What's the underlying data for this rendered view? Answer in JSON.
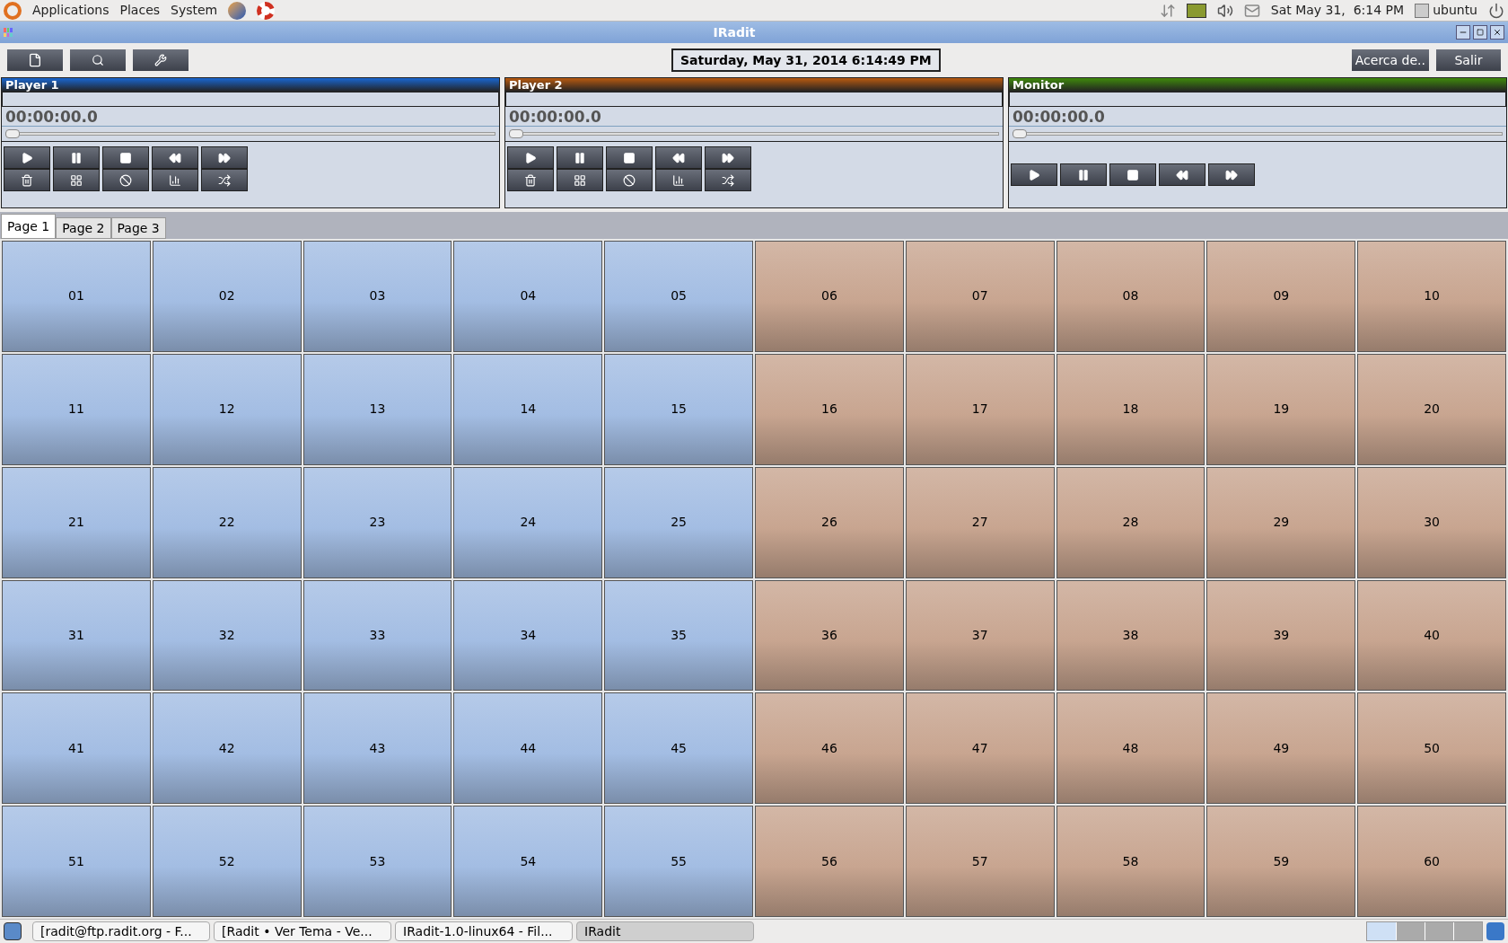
{
  "top_panel": {
    "menus": [
      "Applications",
      "Places",
      "System"
    ],
    "clock": "Sat May 31,  6:14 PM",
    "user": "ubuntu"
  },
  "window": {
    "title": "IRadit"
  },
  "toolbar": {
    "date": "Saturday, May 31, 2014 6:14:49 PM",
    "about": "Acerca de..",
    "exit": "Salir"
  },
  "players": [
    {
      "title": "Player 1",
      "color": "#1a66d0",
      "time": "00:00:00.0",
      "level": 0,
      "kind": "player"
    },
    {
      "title": "Player 2",
      "color": "#b85a10",
      "time": "00:00:00.0",
      "level": 0,
      "kind": "player"
    },
    {
      "title": "Monitor",
      "color": "#3f8a0c",
      "time": "00:00:00.0",
      "level": 0,
      "kind": "monitor"
    }
  ],
  "tabs": [
    {
      "label": "Page 1",
      "selected": true
    },
    {
      "label": "Page 2",
      "selected": false
    },
    {
      "label": "Page 3",
      "selected": false
    }
  ],
  "pads": [
    {
      "label": "01",
      "color": "#a3bde3"
    },
    {
      "label": "02",
      "color": "#a3bde3"
    },
    {
      "label": "03",
      "color": "#a3bde3"
    },
    {
      "label": "04",
      "color": "#a3bde3"
    },
    {
      "label": "05",
      "color": "#a3bde3"
    },
    {
      "label": "06",
      "color": "#c8a590"
    },
    {
      "label": "07",
      "color": "#c8a590"
    },
    {
      "label": "08",
      "color": "#c8a590"
    },
    {
      "label": "09",
      "color": "#c8a590"
    },
    {
      "label": "10",
      "color": "#c8a590"
    },
    {
      "label": "11",
      "color": "#a3bde3"
    },
    {
      "label": "12",
      "color": "#a3bde3"
    },
    {
      "label": "13",
      "color": "#a3bde3"
    },
    {
      "label": "14",
      "color": "#a3bde3"
    },
    {
      "label": "15",
      "color": "#a3bde3"
    },
    {
      "label": "16",
      "color": "#c8a590"
    },
    {
      "label": "17",
      "color": "#c8a590"
    },
    {
      "label": "18",
      "color": "#c8a590"
    },
    {
      "label": "19",
      "color": "#c8a590"
    },
    {
      "label": "20",
      "color": "#c8a590"
    },
    {
      "label": "21",
      "color": "#a3bde3"
    },
    {
      "label": "22",
      "color": "#a3bde3"
    },
    {
      "label": "23",
      "color": "#a3bde3"
    },
    {
      "label": "24",
      "color": "#a3bde3"
    },
    {
      "label": "25",
      "color": "#a3bde3"
    },
    {
      "label": "26",
      "color": "#c8a590"
    },
    {
      "label": "27",
      "color": "#c8a590"
    },
    {
      "label": "28",
      "color": "#c8a590"
    },
    {
      "label": "29",
      "color": "#c8a590"
    },
    {
      "label": "30",
      "color": "#c8a590"
    },
    {
      "label": "31",
      "color": "#a3bde3"
    },
    {
      "label": "32",
      "color": "#a3bde3"
    },
    {
      "label": "33",
      "color": "#a3bde3"
    },
    {
      "label": "34",
      "color": "#a3bde3"
    },
    {
      "label": "35",
      "color": "#a3bde3"
    },
    {
      "label": "36",
      "color": "#c8a590"
    },
    {
      "label": "37",
      "color": "#c8a590"
    },
    {
      "label": "38",
      "color": "#c8a590"
    },
    {
      "label": "39",
      "color": "#c8a590"
    },
    {
      "label": "40",
      "color": "#c8a590"
    },
    {
      "label": "41",
      "color": "#a3bde3"
    },
    {
      "label": "42",
      "color": "#a3bde3"
    },
    {
      "label": "43",
      "color": "#a3bde3"
    },
    {
      "label": "44",
      "color": "#a3bde3"
    },
    {
      "label": "45",
      "color": "#a3bde3"
    },
    {
      "label": "46",
      "color": "#c8a590"
    },
    {
      "label": "47",
      "color": "#c8a590"
    },
    {
      "label": "48",
      "color": "#c8a590"
    },
    {
      "label": "49",
      "color": "#c8a590"
    },
    {
      "label": "50",
      "color": "#c8a590"
    },
    {
      "label": "51",
      "color": "#a3bde3"
    },
    {
      "label": "52",
      "color": "#a3bde3"
    },
    {
      "label": "53",
      "color": "#a3bde3"
    },
    {
      "label": "54",
      "color": "#a3bde3"
    },
    {
      "label": "55",
      "color": "#a3bde3"
    },
    {
      "label": "56",
      "color": "#c8a590"
    },
    {
      "label": "57",
      "color": "#c8a590"
    },
    {
      "label": "58",
      "color": "#c8a590"
    },
    {
      "label": "59",
      "color": "#c8a590"
    },
    {
      "label": "60",
      "color": "#c8a590"
    }
  ],
  "taskbar": [
    {
      "label": "[radit@ftp.radit.org - F...",
      "selected": false
    },
    {
      "label": "[Radit • Ver Tema - Ve...",
      "selected": false
    },
    {
      "label": "IRadit-1.0-linux64 - Fil...",
      "selected": false
    },
    {
      "label": "IRadit",
      "selected": true
    }
  ]
}
